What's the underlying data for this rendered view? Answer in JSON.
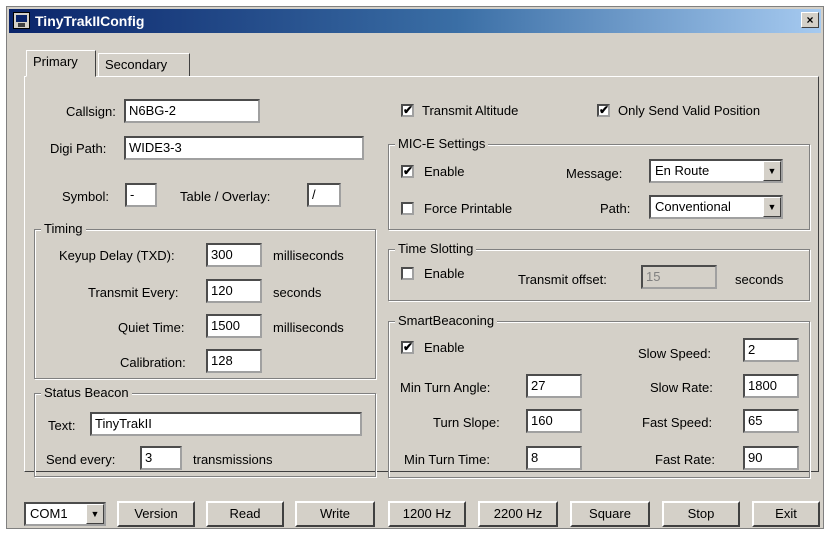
{
  "window": {
    "title": "TinyTrakIIConfig",
    "close_label": "×"
  },
  "tabs": [
    {
      "label": "Primary"
    },
    {
      "label": "Secondary"
    }
  ],
  "primary": {
    "callsign": {
      "label": "Callsign:",
      "value": "N6BG-2"
    },
    "digi_path": {
      "label": "Digi Path:",
      "value": "WIDE3-3"
    },
    "symbol": {
      "label": "Symbol:",
      "value": "-"
    },
    "table_overlay": {
      "label": "Table / Overlay:",
      "value": "/"
    },
    "timing": {
      "title": "Timing",
      "keyup_delay": {
        "label": "Keyup Delay (TXD):",
        "value": "300",
        "unit": "milliseconds"
      },
      "transmit_every": {
        "label": "Transmit Every:",
        "value": "120",
        "unit": "seconds"
      },
      "quiet_time": {
        "label": "Quiet Time:",
        "value": "1500",
        "unit": "milliseconds"
      },
      "calibration": {
        "label": "Calibration:",
        "value": "128"
      }
    },
    "status_beacon": {
      "title": "Status Beacon",
      "text": {
        "label": "Text:",
        "value": "TinyTrakII"
      },
      "send_every": {
        "label": "Send every:",
        "value": "3",
        "unit": "transmissions"
      }
    },
    "transmit_altitude": {
      "label": "Transmit Altitude",
      "checked": true
    },
    "only_valid_position": {
      "label": "Only Send Valid Position",
      "checked": true
    },
    "mic_e": {
      "title": "MIC-E Settings",
      "enable": {
        "label": "Enable",
        "checked": true
      },
      "force_printable": {
        "label": "Force Printable",
        "checked": false
      },
      "message": {
        "label": "Message:",
        "value": "En Route"
      },
      "path": {
        "label": "Path:",
        "value": "Conventional"
      }
    },
    "time_slotting": {
      "title": "Time Slotting",
      "enable": {
        "label": "Enable",
        "checked": false
      },
      "transmit_offset": {
        "label": "Transmit offset:",
        "value": "15",
        "unit": "seconds"
      }
    },
    "smartbeaconing": {
      "title": "SmartBeaconing",
      "enable": {
        "label": "Enable",
        "checked": true
      },
      "slow_speed": {
        "label": "Slow Speed:",
        "value": "2"
      },
      "slow_rate": {
        "label": "Slow Rate:",
        "value": "1800"
      },
      "fast_speed": {
        "label": "Fast Speed:",
        "value": "65"
      },
      "fast_rate": {
        "label": "Fast Rate:",
        "value": "90"
      },
      "min_turn_angle": {
        "label": "Min Turn Angle:",
        "value": "27"
      },
      "turn_slope": {
        "label": "Turn Slope:",
        "value": "160"
      },
      "min_turn_time": {
        "label": "Min Turn Time:",
        "value": "8"
      }
    }
  },
  "bottom": {
    "port": "COM1",
    "version": "Version",
    "read": "Read",
    "write": "Write",
    "hz1200": "1200 Hz",
    "hz2200": "2200 Hz",
    "square": "Square",
    "stop": "Stop",
    "exit": "Exit"
  },
  "check_glyph": "✔",
  "dropdown_glyph": "▼"
}
